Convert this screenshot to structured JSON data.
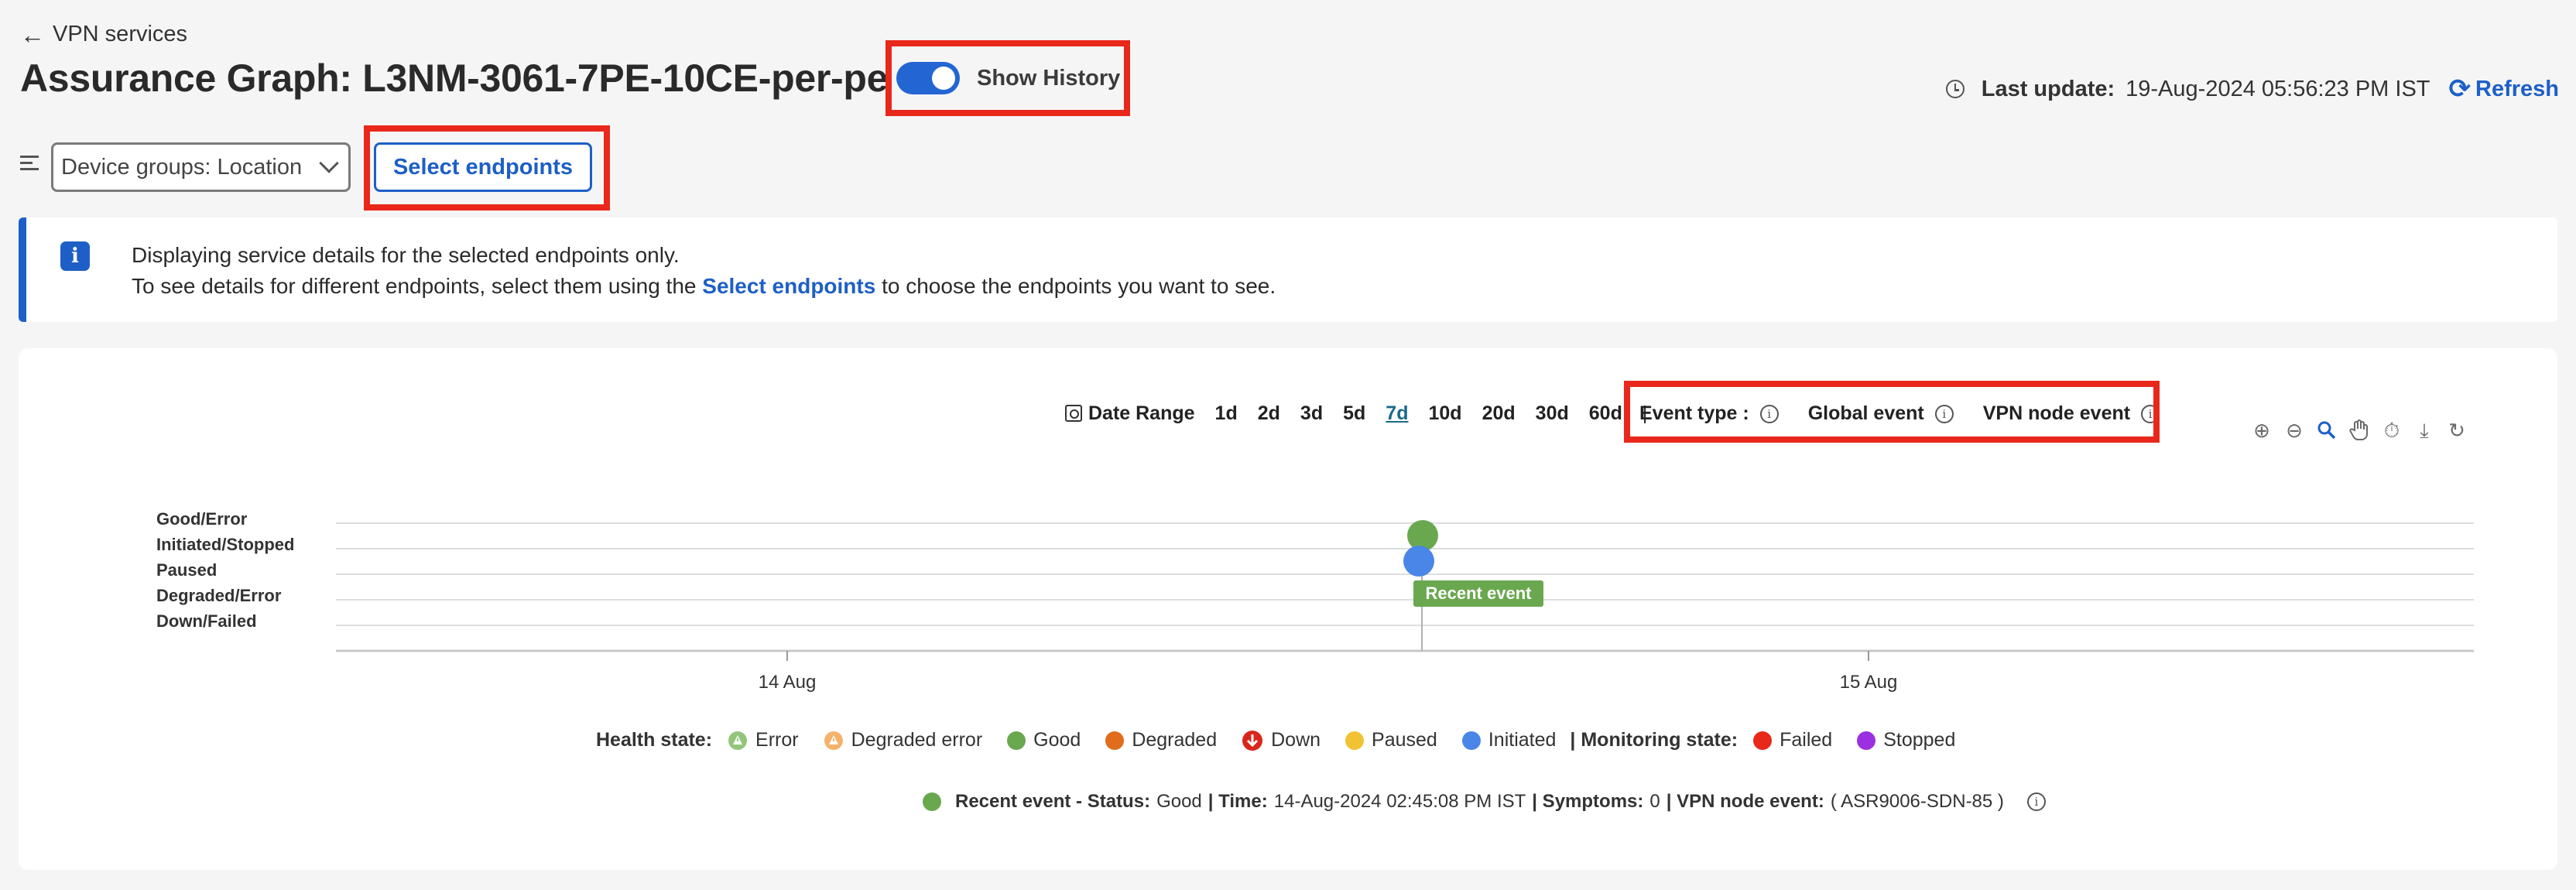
{
  "header": {
    "back_label": "VPN services",
    "title": "Assurance Graph: L3NM-3061-7PE-10CE-per-pe",
    "show_history_label": "Show History",
    "show_history_on": true,
    "last_update_label": "Last update:",
    "last_update_value": "19-Aug-2024 05:56:23 PM IST",
    "refresh_label": "Refresh"
  },
  "toolbar": {
    "device_groups_value": "Device groups: Location",
    "select_endpoints_label": "Select endpoints"
  },
  "banner": {
    "line1": "Displaying service details for the selected endpoints only.",
    "line2_before": "To see details for different endpoints, select them using the",
    "line2_link": "Select endpoints",
    "line2_after": "to choose the endpoints you want to see."
  },
  "chart_controls": {
    "date_range_label": "Date Range",
    "ranges": [
      "1d",
      "2d",
      "3d",
      "5d",
      "7d",
      "10d",
      "20d",
      "30d",
      "60d"
    ],
    "active_range": "7d",
    "separator": "|",
    "event_type_label": "Event type :",
    "global_event_label": "Global event",
    "vpn_node_event_label": "VPN node event"
  },
  "chart_data": {
    "type": "scatter",
    "y_categories": [
      "Good/Error",
      "Initiated/Stopped",
      "Paused",
      "Degraded/Error",
      "Down/Failed"
    ],
    "x_ticks": [
      "14 Aug",
      "15 Aug"
    ],
    "points": [
      {
        "x": "14-Aug-2024 02:45:08 PM IST",
        "y": "Good/Error",
        "state": "Good",
        "color": "#6aa84f"
      },
      {
        "x": "14-Aug-2024 02:45:08 PM IST",
        "y": "Initiated/Stopped",
        "state": "Initiated",
        "color": "#4a86e8"
      }
    ],
    "marker_label": "Recent event"
  },
  "legend": {
    "health_title": "Health state:",
    "health_items": [
      {
        "label": "Error",
        "color": "#93c47d",
        "icon": "warning-icon"
      },
      {
        "label": "Degraded error",
        "color": "#f6b26b",
        "icon": "warning-icon"
      },
      {
        "label": "Good",
        "color": "#6aa84f"
      },
      {
        "label": "Degraded",
        "color": "#e06c1c"
      },
      {
        "label": "Down",
        "color": "#d9261c",
        "icon": "down-arrow-icon"
      },
      {
        "label": "Paused",
        "color": "#f1c232"
      },
      {
        "label": "Initiated",
        "color": "#4a86e8"
      }
    ],
    "monitoring_title": "| Monitoring state:",
    "monitoring_items": [
      {
        "label": "Failed",
        "color": "#e8281b"
      },
      {
        "label": "Stopped",
        "color": "#9b30e0"
      }
    ]
  },
  "recent_event": {
    "prefix": "Recent event - Status:",
    "status": "Good",
    "time_label": "| Time:",
    "time": "14-Aug-2024 02:45:08 PM IST",
    "symptoms_label": "| Symptoms:",
    "symptoms": "0",
    "vpn_label": "| VPN node event:",
    "vpn_value": "( ASR9006-SDN-85 )"
  }
}
